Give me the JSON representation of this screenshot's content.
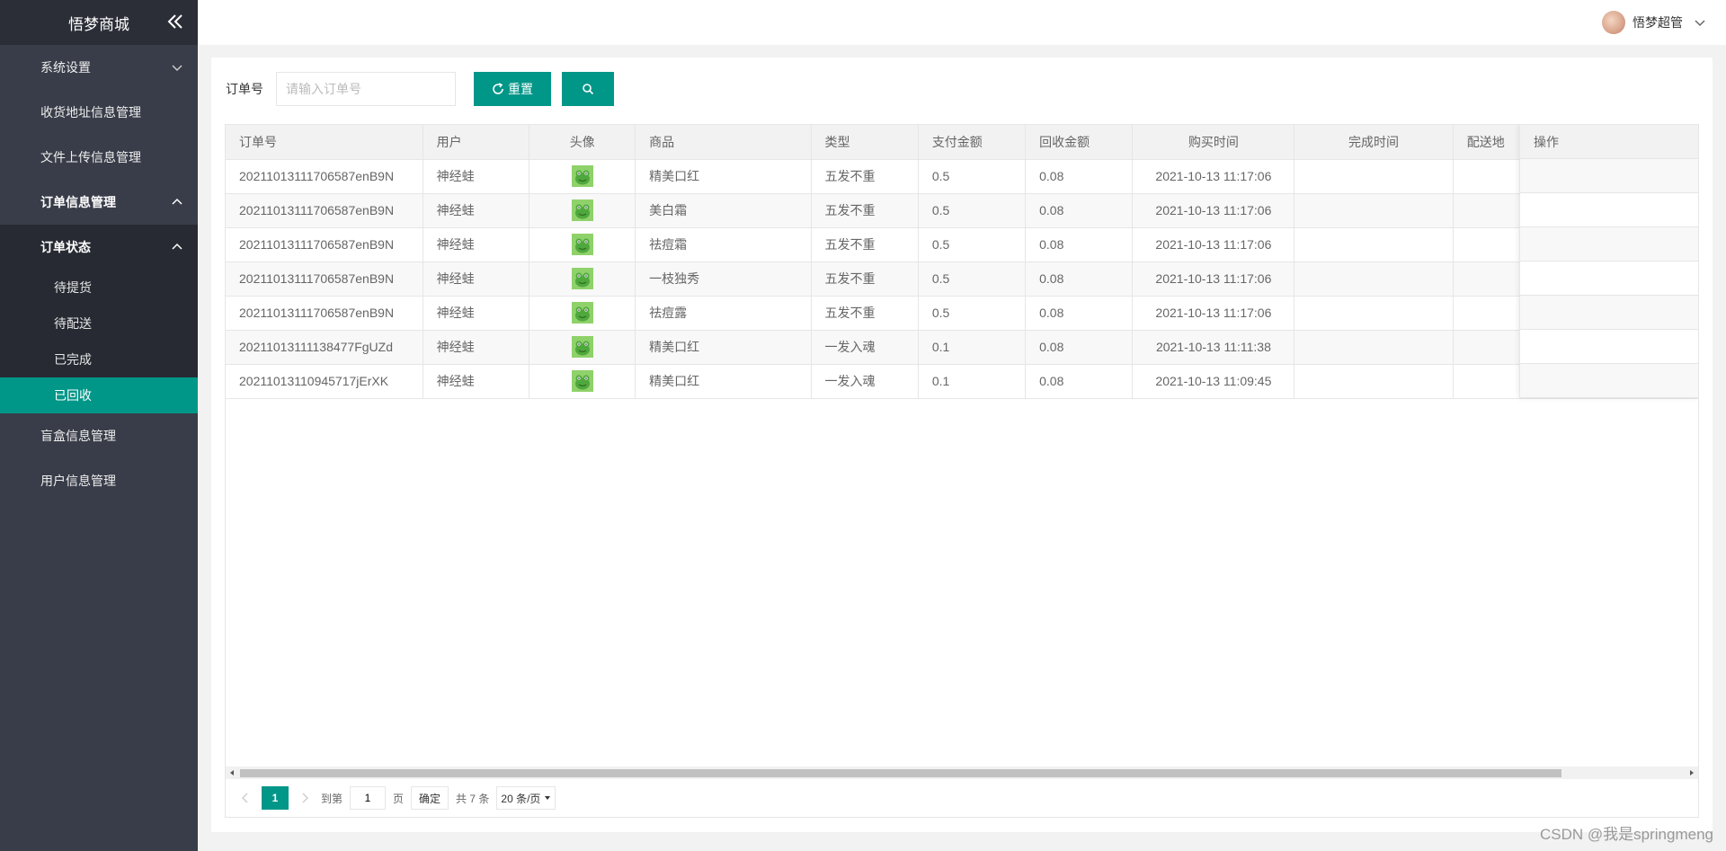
{
  "app": {
    "title": "悟梦商城"
  },
  "header": {
    "username": "悟梦超管"
  },
  "sidebar": {
    "items": [
      {
        "label": "系统设置"
      },
      {
        "label": "收货地址信息管理"
      },
      {
        "label": "文件上传信息管理"
      },
      {
        "label": "订单信息管理"
      },
      {
        "label": "订单状态"
      },
      {
        "label": "盲盒信息管理"
      },
      {
        "label": "用户信息管理"
      }
    ],
    "sub_items": [
      {
        "label": "待提货"
      },
      {
        "label": "待配送"
      },
      {
        "label": "已完成"
      },
      {
        "label": "已回收"
      }
    ]
  },
  "search": {
    "label": "订单号",
    "placeholder": "请输入订单号",
    "reset_label": "重置"
  },
  "table": {
    "columns": [
      "订单号",
      "用户",
      "头像",
      "商品",
      "类型",
      "支付金额",
      "回收金额",
      "购买时间",
      "完成时间",
      "配送地",
      "操作"
    ],
    "rows": [
      [
        "20211013111706587enB9N",
        "神经蛙",
        "",
        "精美口红",
        "五发不重",
        "0.5",
        "0.08",
        "2021-10-13 11:17:06",
        ""
      ],
      [
        "20211013111706587enB9N",
        "神经蛙",
        "",
        "美白霜",
        "五发不重",
        "0.5",
        "0.08",
        "2021-10-13 11:17:06",
        ""
      ],
      [
        "20211013111706587enB9N",
        "神经蛙",
        "",
        "祛痘霜",
        "五发不重",
        "0.5",
        "0.08",
        "2021-10-13 11:17:06",
        ""
      ],
      [
        "20211013111706587enB9N",
        "神经蛙",
        "",
        "一枝独秀",
        "五发不重",
        "0.5",
        "0.08",
        "2021-10-13 11:17:06",
        ""
      ],
      [
        "20211013111706587enB9N",
        "神经蛙",
        "",
        "祛痘露",
        "五发不重",
        "0.5",
        "0.08",
        "2021-10-13 11:17:06",
        ""
      ],
      [
        "20211013111138477FgUZd",
        "神经蛙",
        "",
        "精美口红",
        "一发入魂",
        "0.1",
        "0.08",
        "2021-10-13 11:11:38",
        ""
      ],
      [
        "20211013110945717jErXK",
        "神经蛙",
        "",
        "精美口红",
        "一发入魂",
        "0.1",
        "0.08",
        "2021-10-13 11:09:45",
        ""
      ]
    ]
  },
  "pagination": {
    "current": "1",
    "goto_label": "到第",
    "goto_value": "1",
    "page_label": "页",
    "confirm_label": "确定",
    "total_label": "共 7 条",
    "page_size_label": "20 条/页"
  },
  "watermark": "CSDN @我是springmeng",
  "colors": {
    "accent": "#009688",
    "sidebar_bg": "#393d49",
    "sidebar_dark": "#272a33"
  }
}
